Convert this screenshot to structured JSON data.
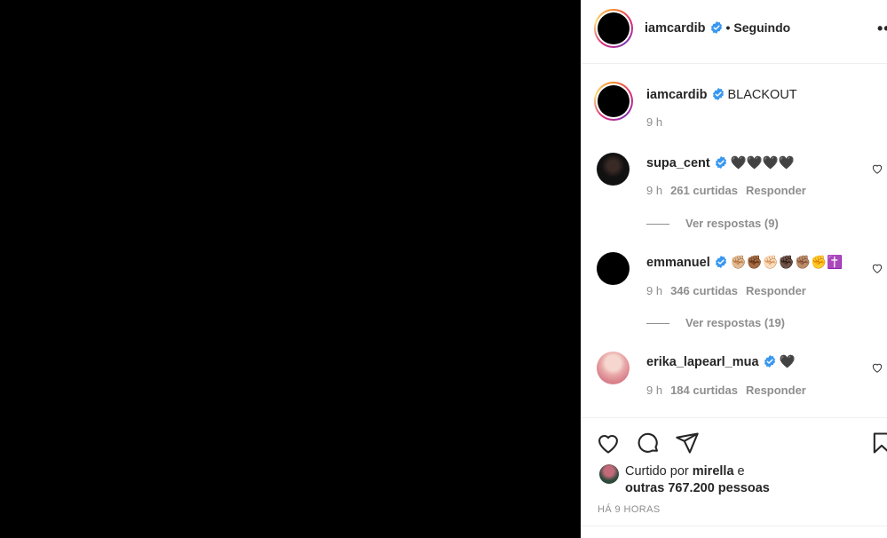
{
  "header": {
    "username": "iamcardib",
    "separator": "•",
    "follow_status": "Seguindo",
    "more_icon": "more-options-icon"
  },
  "caption": {
    "username": "iamcardib",
    "text": "BLACKOUT",
    "time": "9 h"
  },
  "comments": [
    {
      "username": "supa_cent",
      "text": "🖤🖤🖤🖤",
      "time": "9 h",
      "likes": "261 curtidas",
      "reply": "Responder",
      "view_replies": "Ver respostas (9)"
    },
    {
      "username": "emmanuel",
      "text": "✊🏼✊🏾✊🏻✊🏿✊🏽✊✝️",
      "time": "9 h",
      "likes": "346 curtidas",
      "reply": "Responder",
      "view_replies": "Ver respostas (19)"
    },
    {
      "username": "erika_lapearl_mua",
      "text": "🖤",
      "time": "9 h",
      "likes": "184 curtidas",
      "reply": "Responder"
    }
  ],
  "likes_summary": {
    "prefix": "Curtido por",
    "user": "mirella",
    "conj": "e",
    "others": "outras 767.200 pessoas"
  },
  "time_ago": "HÁ 9 HORAS",
  "colors": {
    "verified_blue": "#3897f0",
    "meta_gray": "#8e8e8e",
    "text": "#262626"
  }
}
